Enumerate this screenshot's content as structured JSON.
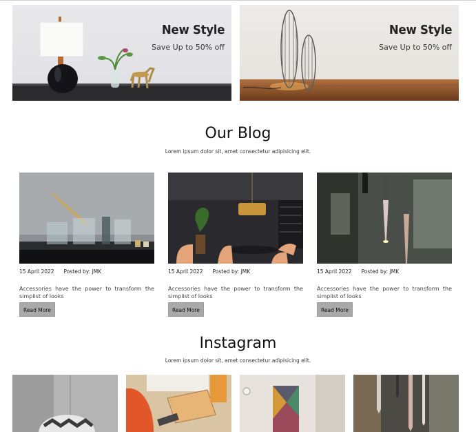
{
  "banners": [
    {
      "title": "New Style",
      "subtitle": "Save Up to 50% off"
    },
    {
      "title": "New Style",
      "subtitle": "Save Up to 50% off"
    }
  ],
  "blog": {
    "title": "Our Blog",
    "subtitle": "Lorem ipsum dolor sit, amet consectetur adipisicing elit.",
    "posts": [
      {
        "date": "15 April 2022",
        "author": "Posted by: JMK",
        "excerpt": "Accessories have the power to transform the simplist of looks",
        "button": "Read More"
      },
      {
        "date": "15 April 2022",
        "author": "Posted by: JMK",
        "excerpt": "Accessories have the power to transform the simplist of looks",
        "button": "Read More"
      },
      {
        "date": "15 April 2022",
        "author": "Posted by: JMK",
        "excerpt": "Accessories have the power to transform the simplist of looks",
        "button": "Read More"
      }
    ]
  },
  "instagram": {
    "title": "Instagram",
    "subtitle": "Lorem ipsum dolor sit, amet consectetur adipisicing elit."
  },
  "colors": {
    "button_bg": "#a9a9a9",
    "heading": "#111111"
  }
}
